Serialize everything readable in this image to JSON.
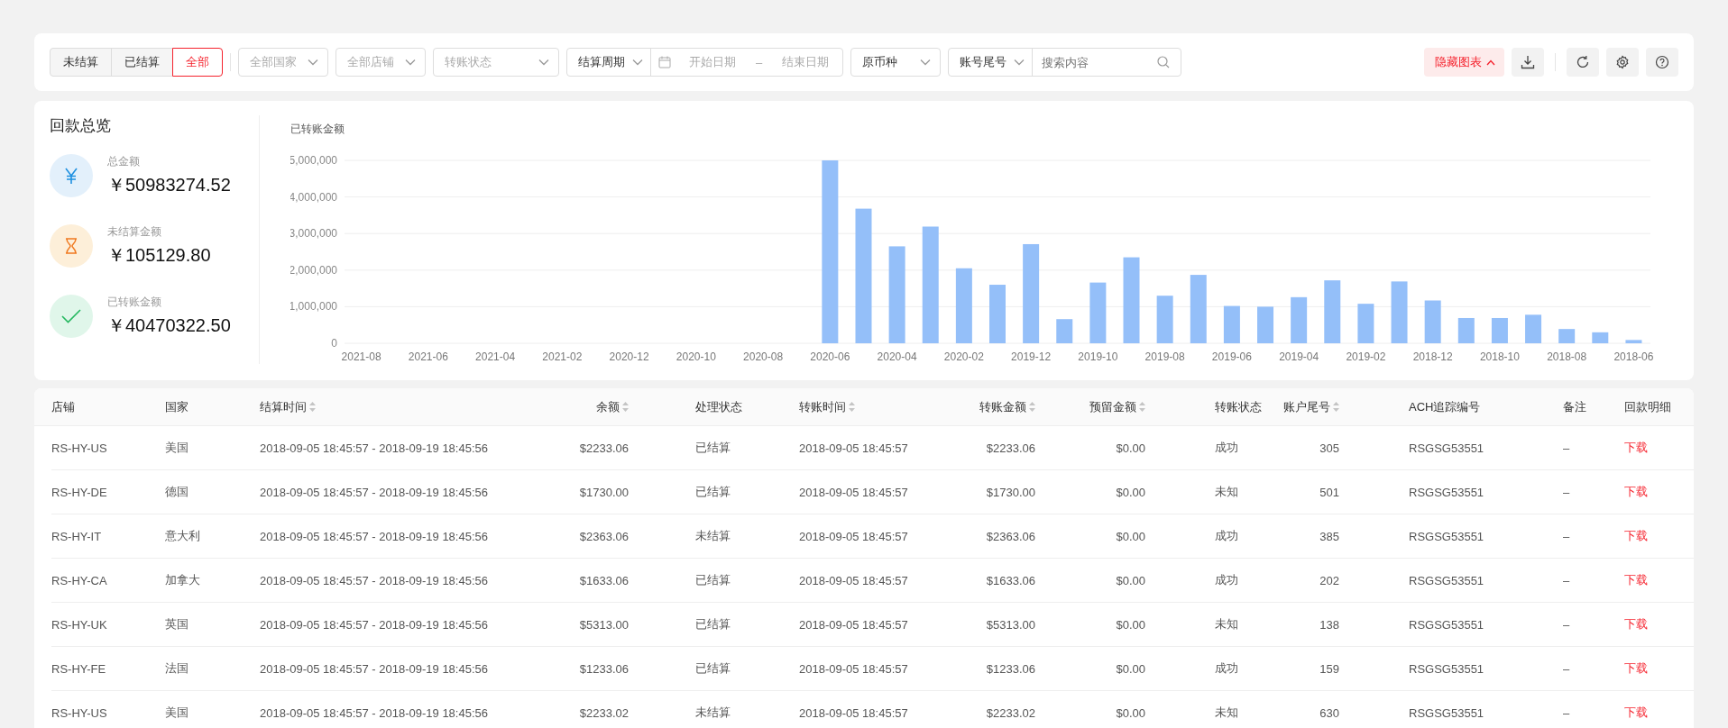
{
  "toolbar": {
    "settle_tabs": [
      {
        "label": "未结算",
        "selected": false
      },
      {
        "label": "已结算",
        "selected": false
      },
      {
        "label": "全部",
        "selected": true
      }
    ],
    "filters": [
      {
        "kind": "select",
        "placeholder": "全部国家"
      },
      {
        "kind": "select",
        "placeholder": "全部店铺"
      },
      {
        "kind": "select",
        "placeholder": "转账状态"
      },
      {
        "kind": "daterange",
        "value": "结算周期",
        "start_placeholder": "开始日期",
        "separator": "–",
        "end_placeholder": "结束日期"
      },
      {
        "kind": "select",
        "value": "原币种"
      },
      {
        "kind": "search",
        "value": "账号尾号",
        "placeholder": "搜索内容"
      }
    ],
    "hide_chart_button": "隐藏图表"
  },
  "summary": {
    "title": "回款总览",
    "items": [
      {
        "kind": "total",
        "label": "总金额",
        "value": "￥50983274.52"
      },
      {
        "kind": "pending",
        "label": "未结算金额",
        "value": "￥105129.80"
      },
      {
        "kind": "transferred",
        "label": "已转账金额",
        "value": "￥40470322.50"
      }
    ]
  },
  "chart": {
    "chart_data": {
      "type": "bar",
      "title": "已转账金额",
      "categories": [
        "2021-08",
        null,
        "2021-06",
        null,
        "2021-04",
        null,
        "2021-02",
        null,
        "2020-12",
        null,
        "2020-10",
        null,
        "2020-08",
        null,
        "2020-06",
        null,
        "2020-04",
        null,
        "2020-02",
        null,
        "2019-12",
        null,
        "2019-10",
        null,
        "2019-08",
        null,
        "2019-06",
        null,
        "2019-04",
        null,
        "2019-02",
        null,
        "2018-12",
        null,
        "2018-10",
        null,
        "2018-08",
        null,
        "2018-06"
      ],
      "grid": true,
      "series": [
        {
          "color": "#94bff9",
          "values": [
            null,
            null,
            null,
            null,
            null,
            null,
            null,
            null,
            null,
            null,
            null,
            null,
            null,
            null,
            5000000,
            3680000,
            2650000,
            3190000,
            2050000,
            1600000,
            2710000,
            660000,
            1660000,
            2350000,
            1300000,
            1870000,
            1020000,
            1000000,
            1260000,
            1720000,
            1080000,
            1690000,
            1170000,
            690000,
            690000,
            780000,
            390000,
            300000,
            90000
          ]
        }
      ],
      "ylim": [
        0,
        5000000
      ],
      "yticks": [
        0,
        {
          "value": 1000000,
          "label": "1,000,000"
        },
        {
          "value": 2000000,
          "label": "2,000,000"
        },
        {
          "value": 3000000,
          "label": "3,000,000"
        },
        {
          "value": 4000000,
          "label": "4,000,000"
        },
        {
          "value": 5000000,
          "label": "5,000,000"
        }
      ]
    }
  },
  "table": {
    "columns": [
      {
        "label": "店铺",
        "sortable": false
      },
      {
        "label": "国家",
        "sortable": false
      },
      {
        "label": "结算时间",
        "sortable": true
      },
      {
        "label": "余额",
        "sortable": true
      },
      {
        "label": "处理状态",
        "sortable": false
      },
      {
        "label": "转账时间",
        "sortable": true
      },
      {
        "label": "转账金额",
        "sortable": true
      },
      {
        "label": "预留金额",
        "sortable": true
      },
      {
        "label": "转账状态",
        "sortable": false
      },
      {
        "label": "账户尾号",
        "sortable": true
      },
      {
        "label": "ACH追踪编号",
        "sortable": false
      },
      {
        "label": "备注",
        "sortable": false
      },
      {
        "label": "回款明细",
        "sortable": false,
        "kind": "link"
      }
    ],
    "rows": [
      [
        "RS-HY-US",
        "美国",
        "2018-09-05 18:45:57 - 2018-09-19 18:45:56",
        "$2233.06",
        "已结算",
        "2018-09-05 18:45:57",
        "$2233.06",
        "$0.00",
        "成功",
        "305",
        "RSGSG53551",
        "–",
        "下载"
      ],
      [
        "RS-HY-DE",
        "德国",
        "2018-09-05 18:45:57 - 2018-09-19 18:45:56",
        "$1730.00",
        "已结算",
        "2018-09-05 18:45:57",
        "$1730.00",
        "$0.00",
        "未知",
        "501",
        "RSGSG53551",
        "–",
        "下载"
      ],
      [
        "RS-HY-IT",
        "意大利",
        "2018-09-05 18:45:57 - 2018-09-19 18:45:56",
        "$2363.06",
        "未结算",
        "2018-09-05 18:45:57",
        "$2363.06",
        "$0.00",
        "成功",
        "385",
        "RSGSG53551",
        "–",
        "下载"
      ],
      [
        "RS-HY-CA",
        "加拿大",
        "2018-09-05 18:45:57 - 2018-09-19 18:45:56",
        "$1633.06",
        "已结算",
        "2018-09-05 18:45:57",
        "$1633.06",
        "$0.00",
        "成功",
        "202",
        "RSGSG53551",
        "–",
        "下载"
      ],
      [
        "RS-HY-UK",
        "英国",
        "2018-09-05 18:45:57 - 2018-09-19 18:45:56",
        "$5313.00",
        "已结算",
        "2018-09-05 18:45:57",
        "$5313.00",
        "$0.00",
        "未知",
        "138",
        "RSGSG53551",
        "–",
        "下载"
      ],
      [
        "RS-HY-FE",
        "法国",
        "2018-09-05 18:45:57 - 2018-09-19 18:45:56",
        "$1233.06",
        "已结算",
        "2018-09-05 18:45:57",
        "$1233.06",
        "$0.00",
        "成功",
        "159",
        "RSGSG53551",
        "–",
        "下载"
      ],
      [
        "RS-HY-US",
        "美国",
        "2018-09-05 18:45:57 - 2018-09-19 18:45:56",
        "$2233.02",
        "未结算",
        "2018-09-05 18:45:57",
        "$2233.02",
        "$0.00",
        "未知",
        "630",
        "RSGSG53551",
        "–",
        "下载"
      ]
    ]
  }
}
